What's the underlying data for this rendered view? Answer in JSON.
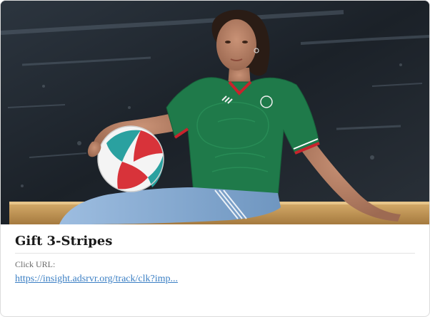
{
  "card": {
    "image_alt": "Woman wearing a green Mexico football jersey holding a soccer ball, seated on a bench against a dark wall",
    "title": "Gift 3-Stripes",
    "click_url_label": "Click URL:",
    "click_url_text": "https://insight.adsrvr.org/track/clk?imp..."
  },
  "colors": {
    "link": "#3b7fc4",
    "title": "#1a1a1a",
    "label": "#6b6b6b",
    "jersey": "#1f7a4a",
    "wall": "#20262d",
    "bench": "#c79a5a",
    "jeans": "#7fa6cc"
  }
}
